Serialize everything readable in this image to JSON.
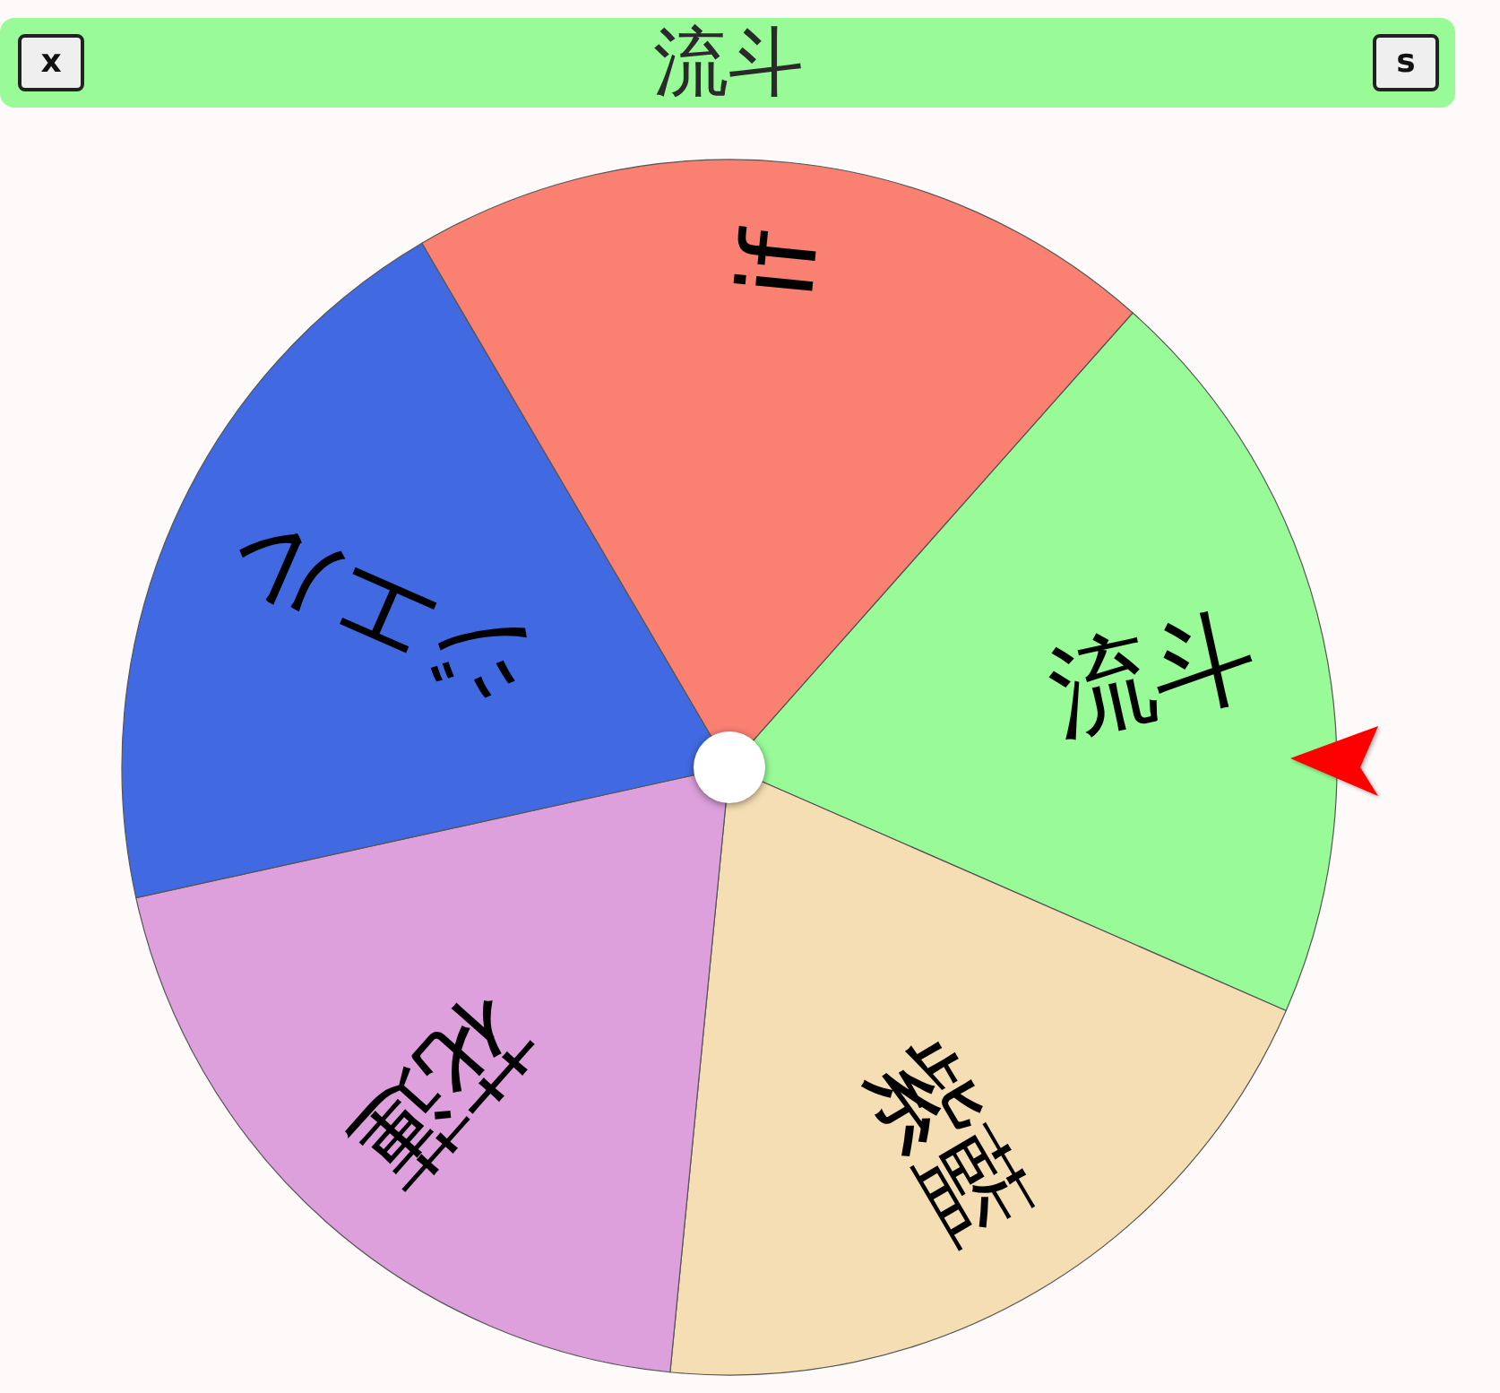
{
  "title_bar": {
    "left_button": "x",
    "title": "流斗",
    "right_button": "s"
  },
  "wheel": {
    "segments": [
      {
        "label": "流斗",
        "color": "#98fb98"
      },
      {
        "label": "紫藍",
        "color": "#f5deb3"
      },
      {
        "label": "花蓮",
        "color": "#dda0dd"
      },
      {
        "label": "ジエル",
        "color": "#4169e1"
      },
      {
        "label": "if",
        "color": "#fa8072"
      }
    ]
  }
}
